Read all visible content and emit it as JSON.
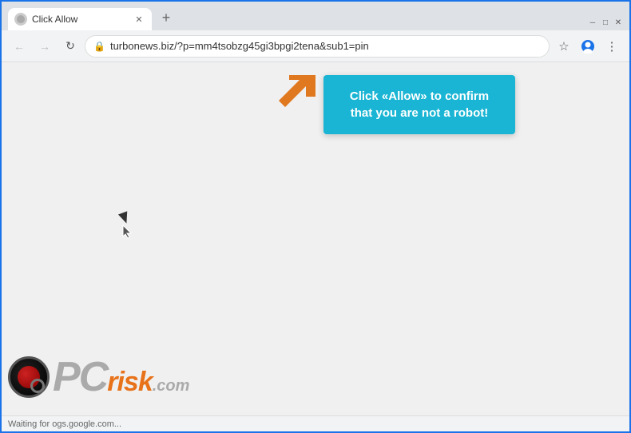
{
  "window": {
    "title": "Click Allow",
    "url": "turbonews.biz/?p=mm4tsobzg45gi3bpgi2tena&sub1=pin"
  },
  "toolbar": {
    "back_label": "←",
    "forward_label": "→",
    "refresh_label": "↻",
    "new_tab_label": "+",
    "bookmark_label": "☆",
    "account_label": "⊙",
    "menu_label": "⋮"
  },
  "notification": {
    "text": "Click «Allow» to confirm that you are not a robot!"
  },
  "status_bar": {
    "text": "Waiting for ogs.google.com..."
  },
  "colors": {
    "notification_bg": "#1ab5d4",
    "arrow_color": "#e07820",
    "tab_active_bg": "#ffffff",
    "toolbar_bg": "#f1f3f4",
    "page_bg": "#f0f0f0",
    "border_accent": "#1a73e8"
  }
}
